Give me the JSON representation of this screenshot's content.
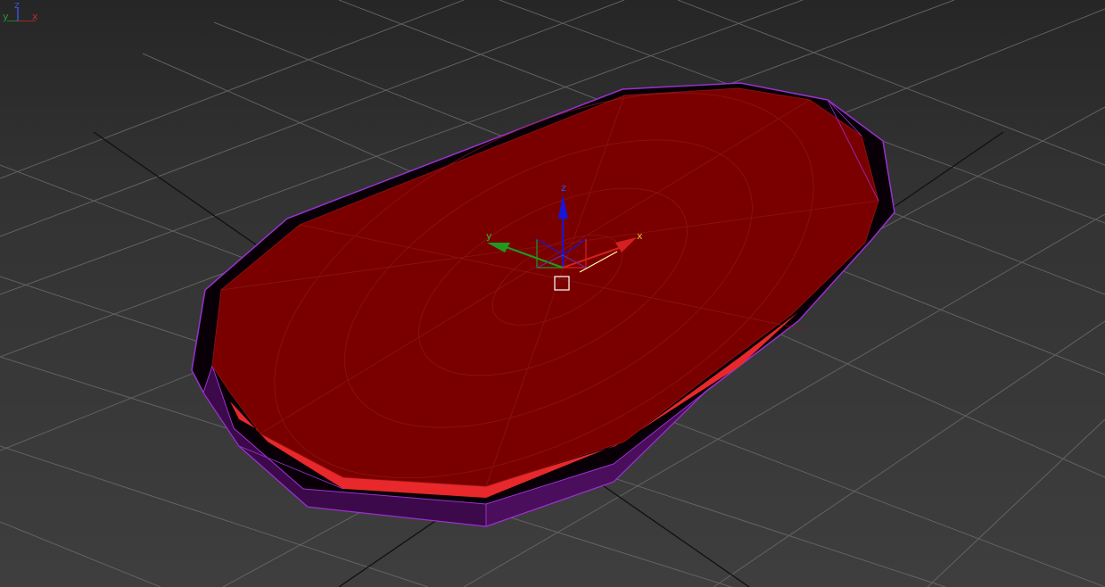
{
  "viewport": {
    "background": "#383838",
    "grid_color": "#6a6a6a",
    "grid_main_axis_color": "#111111"
  },
  "object": {
    "surface_color": "#7a0000",
    "rim_highlight_color": "#e8282a",
    "wire_color": "#9a30d0",
    "side_color": "#0a0008"
  },
  "gizmo": {
    "x_label": "x",
    "y_label": "y",
    "z_label": "z",
    "x_color": "#d42020",
    "y_color": "#1f9a1f",
    "z_color": "#1616d8",
    "x_label_color": "#e8c020",
    "plane_handle_color": "#ffffff"
  },
  "corner_tripod": {
    "x_label": "x",
    "y_label": "y",
    "z_label": "z",
    "x_color": "#c82828",
    "y_color": "#2a9a2a",
    "z_color": "#3a52d8"
  }
}
